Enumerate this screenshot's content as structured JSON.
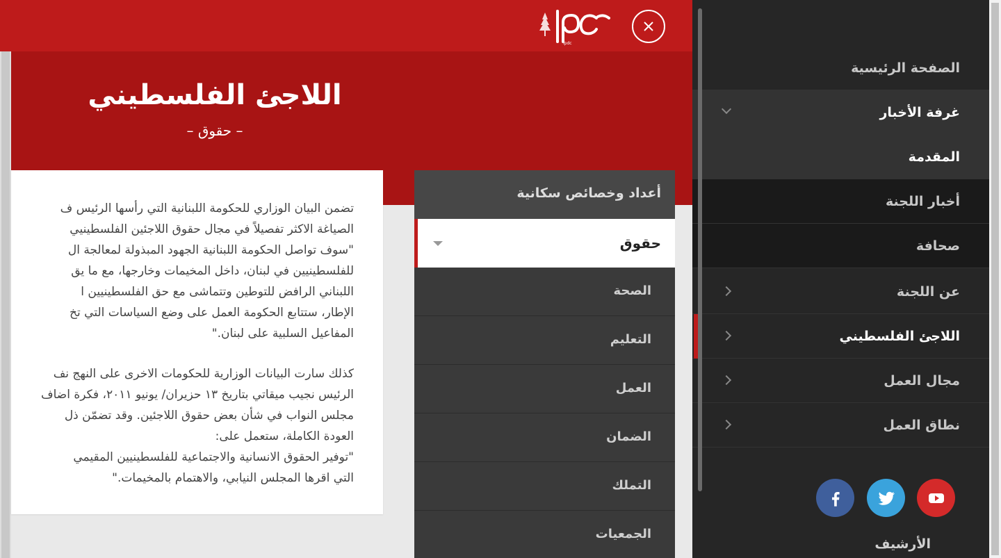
{
  "header": {
    "logo_text": "lpdc",
    "close_icon": "close-icon"
  },
  "hero": {
    "title": "اللاجئ الفلسطيني",
    "subtitle": "– حقوق –"
  },
  "content": {
    "paragraph1": [
      "تضمن البيان الوزاري للحكومة اللبنانية التي رأسها الرئيس ف",
      "الصياغة الاكثر تفصيلاً في مجال حقوق اللاجئين الفلسطينيي",
      "\"سوف تواصل الحكومة اللبنانية الجهود المبذولة لمعالجة ال",
      "للفلسطينيين في لبنان، داخل المخيمات وخارجها، مع ما يق",
      "اللبناني الرافض للتوطين وتتماشى مع حق الفلسطينيين ا",
      "الإطار، ستتابع الحكومة العمل على وضع السياسات التي تخ",
      "المفاعيل السلبية على لبنان.\""
    ],
    "paragraph2": [
      "كذلك سارت البيانات الوزارية للحكومات الاخرى على النهج نف",
      "الرئيس نجيب ميقاتي بتاريخ ١٣ حزيران/ يونيو ٢٠١١، فكرة اضاف",
      "مجلس النواب في شأن بعض حقوق اللاجئين. وقد تضمّن ذل",
      "العودة الكاملة، ستعمل على:",
      "\"توفير الحقوق الانسانية والاجتماعية للفلسطينيين المقيمي",
      "التي اقرها المجلس النيابي، والاهتمام بالمخيمات.\""
    ]
  },
  "subnav": {
    "header": "أعداد وخصائص سكانية",
    "active": "حقوق",
    "items": [
      "الصحة",
      "التعليم",
      "العمل",
      "الضمان",
      "التملك",
      "الجمعيات"
    ]
  },
  "sidebar": {
    "items": [
      {
        "label": "الصفحة الرئيسية"
      },
      {
        "label": "غرفة الأخبار"
      },
      {
        "label": "المقدمة"
      },
      {
        "label": "أخبار اللجنة"
      },
      {
        "label": "صحافة"
      },
      {
        "label": "عن اللجنة"
      },
      {
        "label": "اللاجئ الفلسطيني"
      },
      {
        "label": "مجال العمل"
      },
      {
        "label": "نطاق العمل"
      }
    ],
    "archive": "الأرشيف",
    "social": [
      {
        "icon": "youtube-icon",
        "color": "#d42a2a"
      },
      {
        "icon": "twitter-icon",
        "color": "#3aa3dc"
      },
      {
        "icon": "facebook-icon",
        "color": "#3f5f9c"
      }
    ]
  },
  "colors": {
    "brand_red": "#be1b1b",
    "hero_red": "#a81414",
    "sidebar_bg": "#262626"
  }
}
